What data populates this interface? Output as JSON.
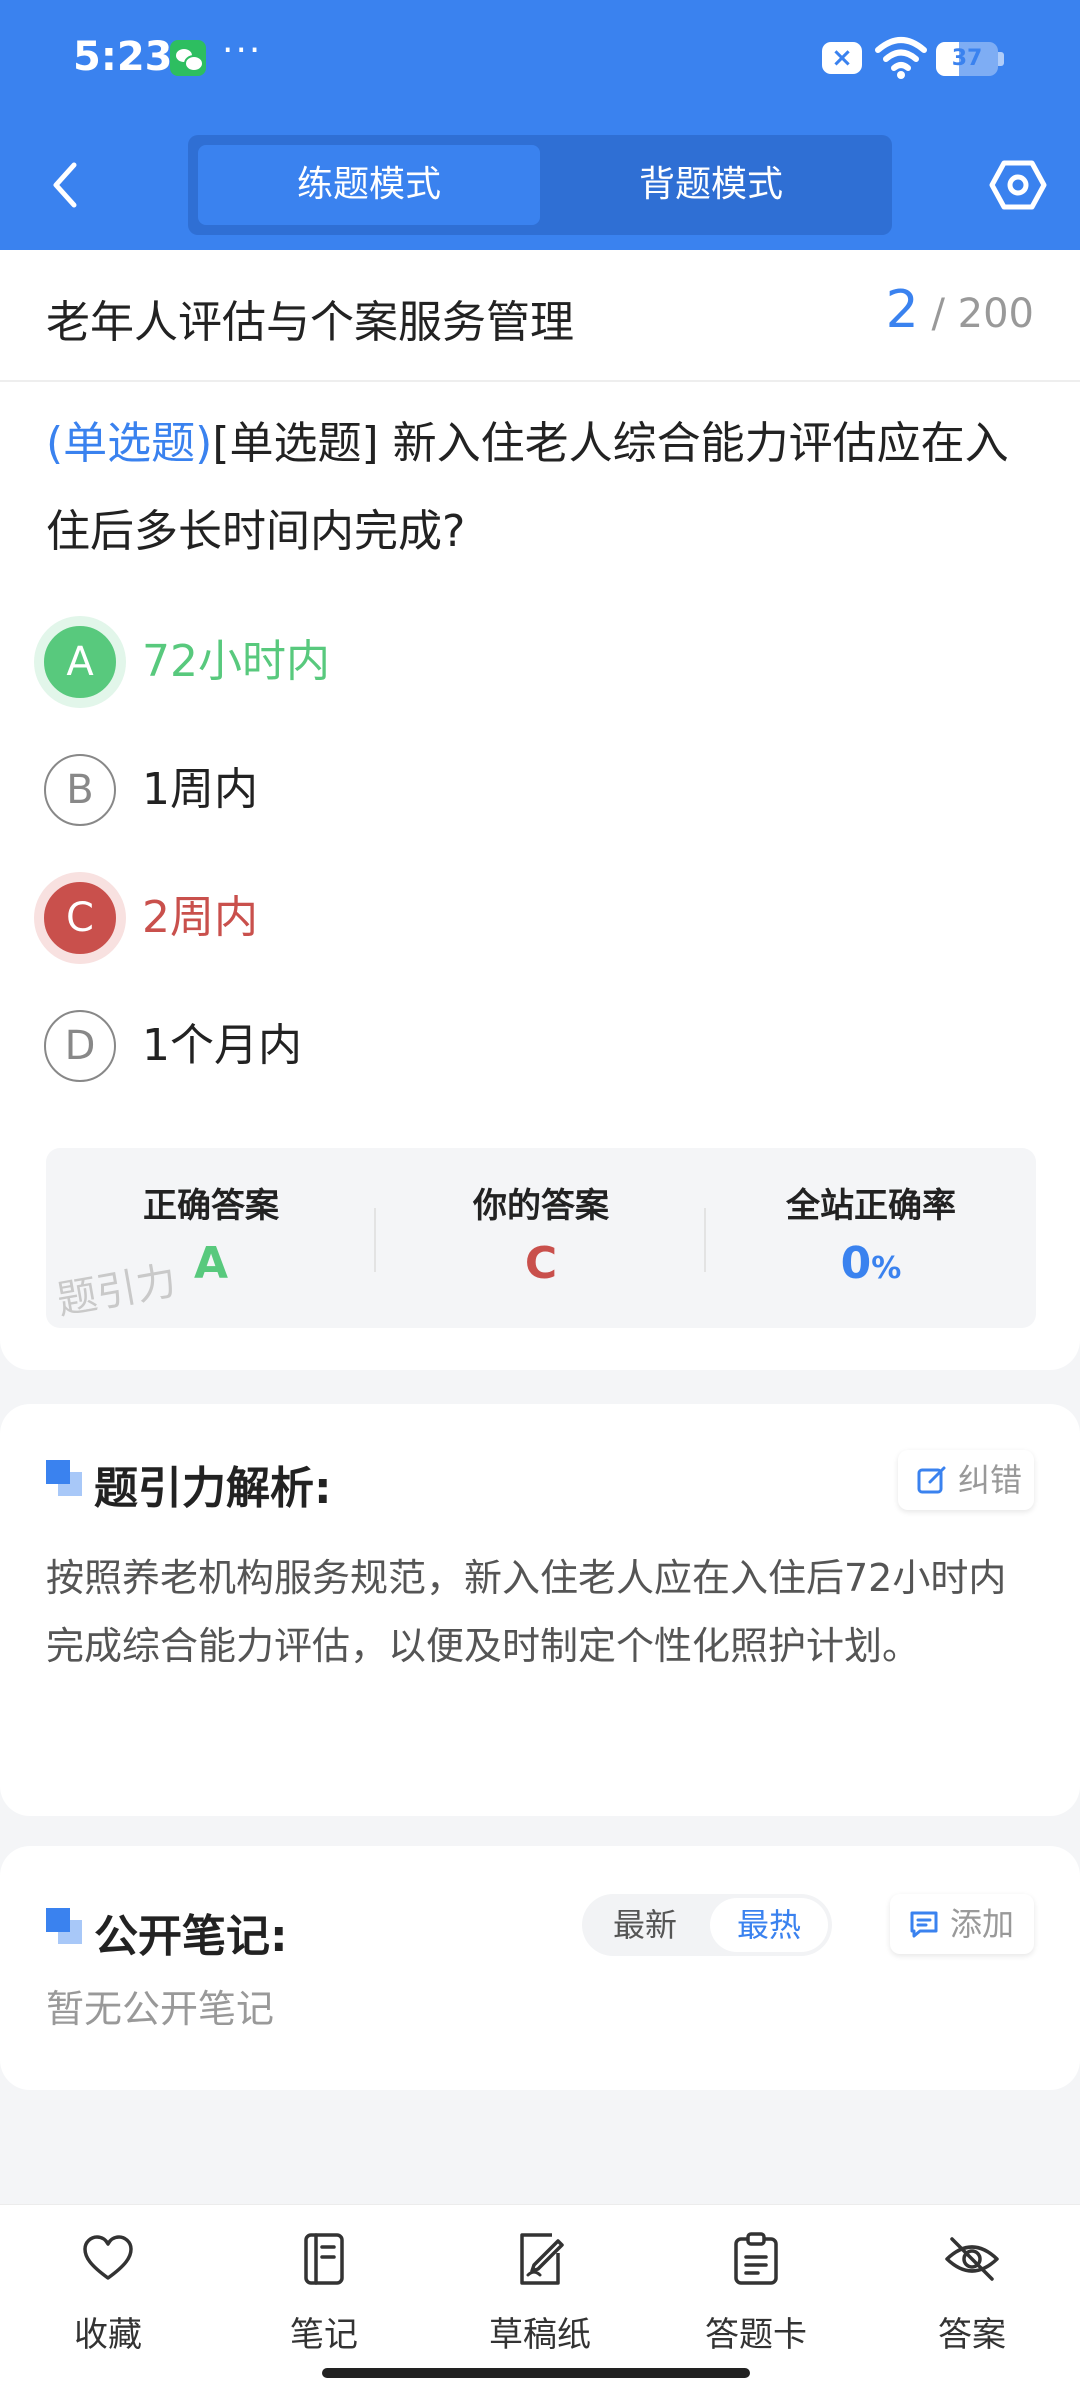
{
  "status_bar": {
    "time": "5:23",
    "more": "···",
    "battery": "37",
    "battery_level": 0.37
  },
  "header": {
    "mode_practice": "练题模式",
    "mode_memorize": "背题模式",
    "active_mode": "练题模式"
  },
  "question": {
    "subject": "老年人评估与个案服务管理",
    "progress_current": "2",
    "progress_total": "/ 200",
    "type": "(单选题)",
    "text": "[单选题] 新入住老人综合能力评估应在入住后多长时间内完成?",
    "options": [
      {
        "letter": "A",
        "text": "72小时内",
        "state": "correct"
      },
      {
        "letter": "B",
        "text": "1周内",
        "state": "normal"
      },
      {
        "letter": "C",
        "text": "2周内",
        "state": "wrong"
      },
      {
        "letter": "D",
        "text": "1个月内",
        "state": "normal"
      }
    ]
  },
  "summary": {
    "correct_label": "正确答案",
    "correct_value": "A",
    "your_label": "你的答案",
    "your_value": "C",
    "rate_label": "全站正确率",
    "rate_value": "0",
    "rate_unit": "%",
    "watermark": "题引力",
    "colors": {
      "correct": "#58c97d",
      "wrong": "#c9504c",
      "accent": "#3a82ef"
    }
  },
  "analysis": {
    "title": "题引力解析:",
    "report_label": "纠错",
    "text": "按照养老机构服务规范，新入住老人应在入住后72小时内完成综合能力评估，以便及时制定个性化照护计划。"
  },
  "notes": {
    "title": "公开笔记:",
    "sort_newest": "最新",
    "sort_hottest": "最热",
    "add_label": "添加",
    "empty": "暂无公开笔记"
  },
  "tabbar": {
    "favorite": "收藏",
    "notes": "笔记",
    "draft": "草稿纸",
    "answer_card": "答题卡",
    "answer": "答案"
  }
}
